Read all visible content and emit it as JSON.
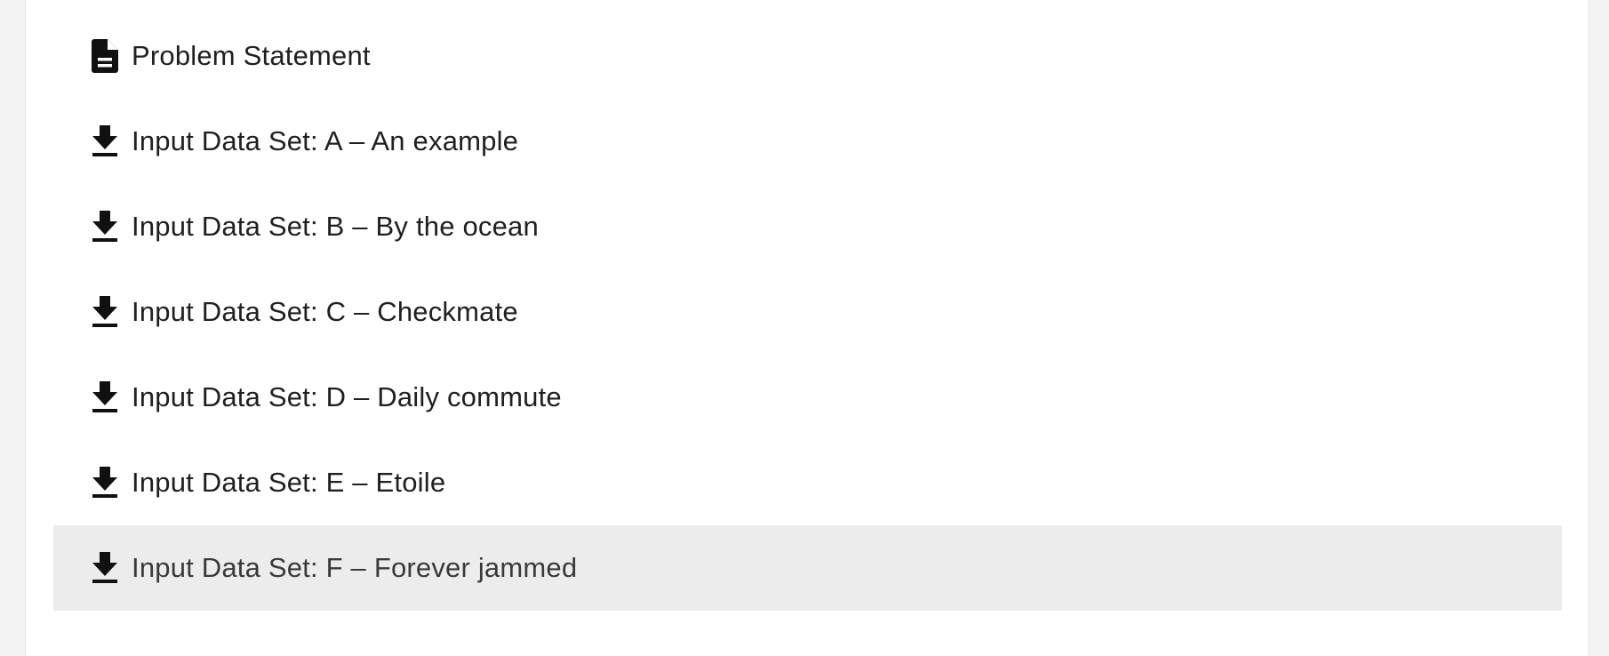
{
  "items": [
    {
      "label": "Problem Statement",
      "icon": "document-icon",
      "highlighted": false
    },
    {
      "label": "Input Data Set: A – An example",
      "icon": "download-icon",
      "highlighted": false
    },
    {
      "label": "Input Data Set: B – By the ocean",
      "icon": "download-icon",
      "highlighted": false
    },
    {
      "label": "Input Data Set: C – Checkmate",
      "icon": "download-icon",
      "highlighted": false
    },
    {
      "label": "Input Data Set: D – Daily commute",
      "icon": "download-icon",
      "highlighted": false
    },
    {
      "label": "Input Data Set: E – Etoile",
      "icon": "download-icon",
      "highlighted": false
    },
    {
      "label": "Input Data Set: F – Forever jammed",
      "icon": "download-icon",
      "highlighted": true
    }
  ],
  "colors": {
    "page_background": "#f3f3f3",
    "card_background": "#ffffff",
    "highlight_background": "#ececec",
    "text": "#202020",
    "icon": "#111111"
  }
}
